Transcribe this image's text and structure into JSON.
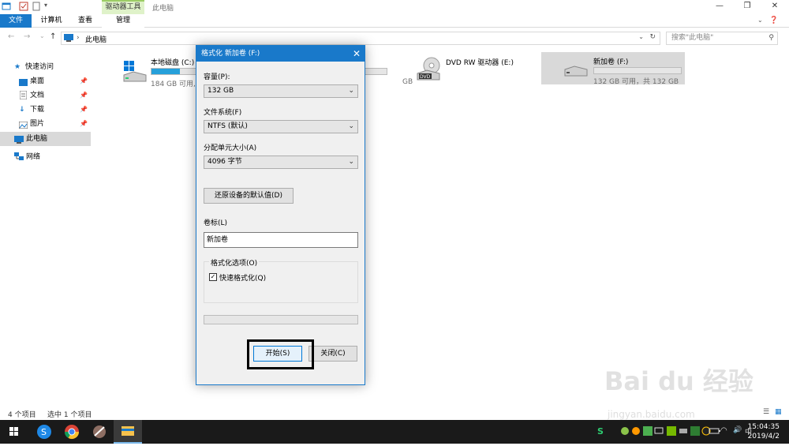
{
  "titlebar": {
    "context_tab_group": "驱动器工具",
    "window_title": "此电脑"
  },
  "ribbon": {
    "tabs": [
      "文件",
      "计算机",
      "查看",
      "管理"
    ]
  },
  "address": {
    "path": "此电脑",
    "search_placeholder": "搜索\"此电脑\""
  },
  "sidebar": {
    "items": [
      {
        "label": "快速访问",
        "icon": "star-icon",
        "pinned": false
      },
      {
        "label": "桌面",
        "icon": "desktop-icon",
        "pinned": true
      },
      {
        "label": "文档",
        "icon": "document-icon",
        "pinned": true
      },
      {
        "label": "下载",
        "icon": "download-icon",
        "pinned": true
      },
      {
        "label": "图片",
        "icon": "picture-icon",
        "pinned": true
      },
      {
        "label": "此电脑",
        "icon": "computer-icon",
        "pinned": false,
        "selected": true
      },
      {
        "label": "网络",
        "icon": "network-icon",
        "pinned": false
      }
    ]
  },
  "drives": [
    {
      "name": "本地磁盘 (C:)",
      "capacity": "184 GB 可用,",
      "capacity_tail": "GB",
      "used_fraction": 0.12
    },
    {
      "name": "DVD RW 驱动器 (E:)",
      "capacity": "",
      "used_fraction": null
    },
    {
      "name": "新加卷 (F:)",
      "capacity": "132 GB 可用，共 132 GB",
      "used_fraction": 0.0,
      "selected": true
    }
  ],
  "dialog": {
    "title": "格式化 新加卷 (F:)",
    "capacity_label": "容量(P):",
    "capacity_value": "132 GB",
    "fs_label": "文件系统(F)",
    "fs_value": "NTFS (默认)",
    "alloc_label": "分配单元大小(A)",
    "alloc_value": "4096 字节",
    "restore_button": "还原设备的默认值(D)",
    "volume_label": "卷标(L)",
    "volume_value": "新加卷",
    "options_label": "格式化选项(O)",
    "quick_format": "快速格式化(Q)",
    "quick_format_checked": true,
    "start_button": "开始(S)",
    "close_button": "关闭(C)"
  },
  "status": {
    "items_count": "4 个项目",
    "selected_count": "选中 1 个项目"
  },
  "taskbar": {
    "time": "15:04:35",
    "date": "2019/4/2"
  },
  "watermark": {
    "main": "Bai du 经验",
    "sub": "jingyan.baidu.com"
  },
  "colors": {
    "accent": "#1979ca",
    "context_tab": "#dff2c9",
    "progress": "#26a0da"
  }
}
